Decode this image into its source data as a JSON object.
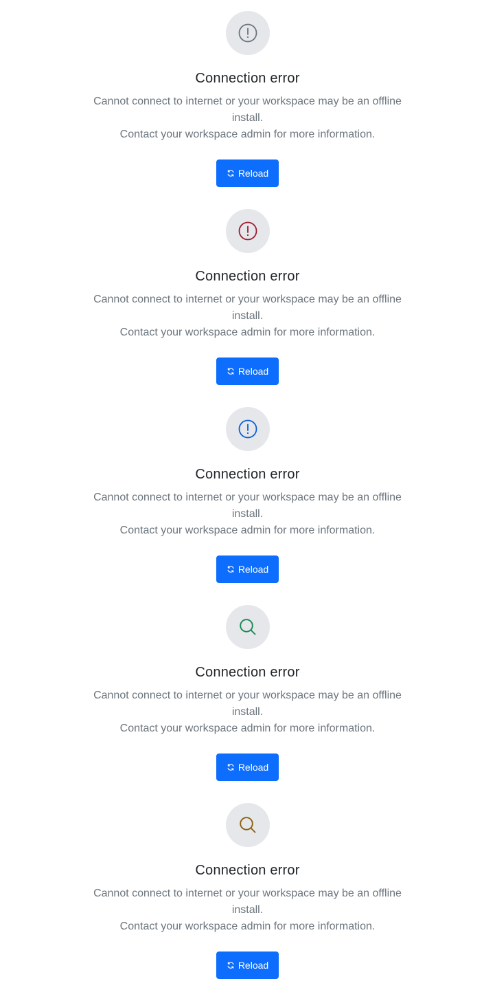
{
  "errors": [
    {
      "icon": "exclamation-circle-icon",
      "icon_color": "#6c757d",
      "title": "Connection error",
      "line1": "Cannot connect to internet or your workspace may be an offline install.",
      "line2": "Contact your workspace admin for more information.",
      "button_label": "Reload"
    },
    {
      "icon": "exclamation-circle-icon",
      "icon_color": "#9b1c2c",
      "title": "Connection error",
      "line1": "Cannot connect to internet or your workspace may be an offline install.",
      "line2": "Contact your workspace admin for more information.",
      "button_label": "Reload"
    },
    {
      "icon": "exclamation-circle-icon",
      "icon_color": "#0b5ed7",
      "title": "Connection error",
      "line1": "Cannot connect to internet or your workspace may be an offline install.",
      "line2": "Contact your workspace admin for more information.",
      "button_label": "Reload"
    },
    {
      "icon": "search-icon",
      "icon_color": "#198754",
      "title": "Connection error",
      "line1": "Cannot connect to internet or your workspace may be an offline install.",
      "line2": "Contact your workspace admin for more information.",
      "button_label": "Reload"
    },
    {
      "icon": "search-icon",
      "icon_color": "#8a6110",
      "title": "Connection error",
      "line1": "Cannot connect to internet or your workspace may be an offline install.",
      "line2": "Contact your workspace admin for more information.",
      "button_label": "Reload"
    }
  ],
  "button_color": "#0d6efd"
}
